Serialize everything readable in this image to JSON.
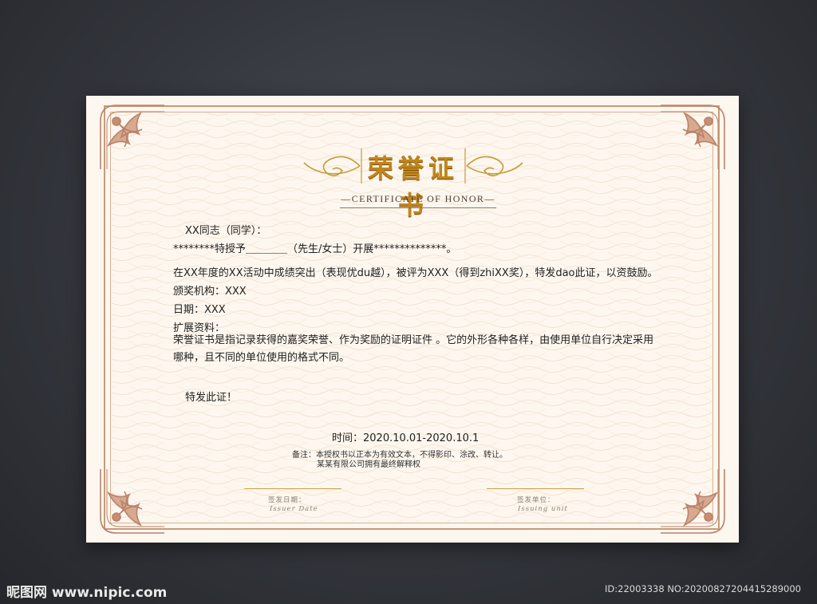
{
  "certificate": {
    "title": "荣誉证书",
    "subtitle": "CERTIFICATE OF HONOR",
    "salutation": "XX同志（同学）：",
    "grant_line": "********特授予＿＿＿＿（先生/女士）开展**************。",
    "achievement_line": "在XX年度的XX活动中成绩突出（表现优du越），被评为XXX（得到zhiXX奖），特发dao此证，以资鼓励。",
    "issuer_line": "颁奖机构：XXX",
    "date_line": "日期：XXX",
    "extra_label": "扩展资料：",
    "description": "荣誉证书是指记录获得的嘉奖荣誉、作为奖励的证明证件 。它的外形各种各样，由使用单位自行决定采用哪种，且不同的单位使用的格式不同。",
    "closing": "特发此证！",
    "time_line": "时间：2020.10.01-2020.10.1",
    "note_line1": "备注：本授权书以正本为有效文本，不得影印、涂改、转让。",
    "note_line2": "某某有限公司拥有最终解释权",
    "sign_date_label": "签发日期：",
    "sign_date_label_en": "Issuer Date",
    "sign_unit_label": "签发单位：",
    "sign_unit_label_en": "Issuing unit"
  },
  "watermark": {
    "site": "昵图网 www.nipic.com",
    "id_text": "ID:22003338 NO:20200827204415289000"
  },
  "colors": {
    "background": "#2f3237",
    "paper": "#fdf7ef",
    "frame": "#c79a7a",
    "title_gold": "#c1861a",
    "signature_line": "#c9a046"
  },
  "icons": [
    "corner-ornament-icon",
    "title-flourish-icon"
  ]
}
